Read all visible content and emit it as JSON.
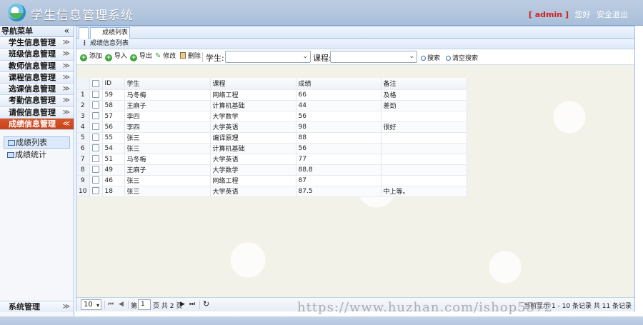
{
  "header": {
    "app_title": "学生信息管理系统",
    "user_open": "[",
    "user_name": "admin",
    "user_close": "]",
    "greeting": "您好",
    "logout": "安全退出"
  },
  "sidebar": {
    "title": "导航菜单",
    "collapse_icon": "double-chevron-left-icon",
    "groups": [
      {
        "label": "学生信息管理"
      },
      {
        "label": "班级信息管理"
      },
      {
        "label": "教师信息管理"
      },
      {
        "label": "课程信息管理"
      },
      {
        "label": "选课信息管理"
      },
      {
        "label": "考勤信息管理"
      },
      {
        "label": "请假信息管理"
      },
      {
        "label": "成绩信息管理",
        "active": true
      }
    ],
    "sub_items": [
      {
        "label": "成绩列表",
        "selected": true
      },
      {
        "label": "成绩统计"
      }
    ],
    "system": "系统管理"
  },
  "tabs": {
    "active_tab": "成绩列表",
    "close": "×"
  },
  "panel": {
    "title": "成绩信息列表"
  },
  "toolbar": {
    "add": "添加",
    "import": "导入",
    "export": "导出",
    "edit": "修改",
    "delete": "删除",
    "student_label": "学生:",
    "student_value": "",
    "course_label": "课程:",
    "course_value": "",
    "search": "搜索",
    "clear_search": "清空搜索"
  },
  "grid": {
    "columns": [
      "ID",
      "学生",
      "课程",
      "成绩",
      "备注"
    ],
    "rows": [
      {
        "rn": "1",
        "id": "59",
        "student": "马冬梅",
        "course": "网络工程",
        "score": "66",
        "note": "及格"
      },
      {
        "rn": "2",
        "id": "58",
        "student": "王麻子",
        "course": "计算机基础",
        "score": "44",
        "note": "差劲"
      },
      {
        "rn": "3",
        "id": "57",
        "student": "李四",
        "course": "大学数学",
        "score": "56",
        "note": ""
      },
      {
        "rn": "4",
        "id": "56",
        "student": "李四",
        "course": "大学英语",
        "score": "98",
        "note": "很好"
      },
      {
        "rn": "5",
        "id": "55",
        "student": "张三",
        "course": "编译原理",
        "score": "88",
        "note": ""
      },
      {
        "rn": "6",
        "id": "54",
        "student": "张三",
        "course": "计算机基础",
        "score": "56",
        "note": ""
      },
      {
        "rn": "7",
        "id": "51",
        "student": "马冬梅",
        "course": "大学英语",
        "score": "77",
        "note": ""
      },
      {
        "rn": "8",
        "id": "49",
        "student": "王麻子",
        "course": "大学数学",
        "score": "88.8",
        "note": ""
      },
      {
        "rn": "9",
        "id": "46",
        "student": "张三",
        "course": "网络工程",
        "score": "87",
        "note": ""
      },
      {
        "rn": "10",
        "id": "18",
        "student": "张三",
        "course": "大学英语",
        "score": "87.5",
        "note": "中上等。"
      }
    ]
  },
  "pager": {
    "page_size": "10",
    "page_prefix": "第",
    "page_number": "1",
    "page_suffix": "页 共 2 页",
    "info": "当前显示 1 - 10 条记录 共 11 条记录"
  },
  "watermark": "https://www.huzhan.com/ishop5572"
}
